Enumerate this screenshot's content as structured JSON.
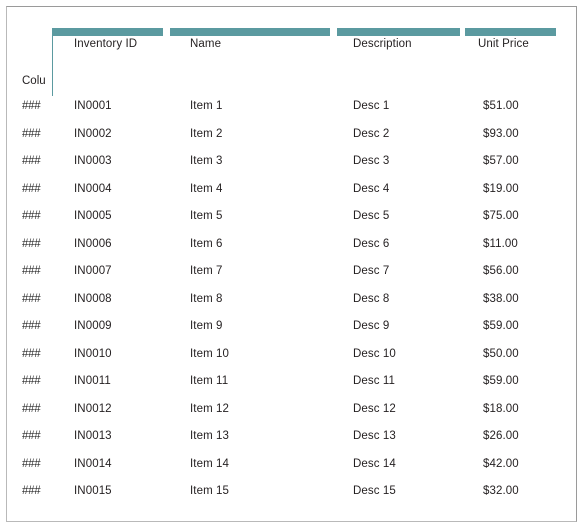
{
  "document": {
    "type": "inventory-table",
    "accent_color": "#5b9aa0",
    "text_color": "#231f20",
    "background_color": "#ffffff",
    "border_color": "#9a9a9a"
  },
  "table": {
    "row_header_stub": "Colu",
    "columns": [
      {
        "key": "row_num",
        "label": "",
        "banded": false
      },
      {
        "key": "inventory_id",
        "label": "Inventory ID",
        "banded": true
      },
      {
        "key": "name",
        "label": "Name",
        "banded": true
      },
      {
        "key": "description",
        "label": "Description",
        "banded": true
      },
      {
        "key": "unit_price",
        "label": "Unit Price",
        "banded": true
      }
    ],
    "rows": [
      {
        "row_num": "###",
        "inventory_id": "IN0001",
        "name": "Item 1",
        "description": "Desc 1",
        "unit_price": "$51.00"
      },
      {
        "row_num": "###",
        "inventory_id": "IN0002",
        "name": "Item 2",
        "description": "Desc 2",
        "unit_price": "$93.00"
      },
      {
        "row_num": "###",
        "inventory_id": "IN0003",
        "name": "Item 3",
        "description": "Desc 3",
        "unit_price": "$57.00"
      },
      {
        "row_num": "###",
        "inventory_id": "IN0004",
        "name": "Item 4",
        "description": "Desc 4",
        "unit_price": "$19.00"
      },
      {
        "row_num": "###",
        "inventory_id": "IN0005",
        "name": "Item 5",
        "description": "Desc 5",
        "unit_price": "$75.00"
      },
      {
        "row_num": "###",
        "inventory_id": "IN0006",
        "name": "Item 6",
        "description": "Desc 6",
        "unit_price": "$11.00"
      },
      {
        "row_num": "###",
        "inventory_id": "IN0007",
        "name": "Item 7",
        "description": "Desc 7",
        "unit_price": "$56.00"
      },
      {
        "row_num": "###",
        "inventory_id": "IN0008",
        "name": "Item 8",
        "description": "Desc 8",
        "unit_price": "$38.00"
      },
      {
        "row_num": "###",
        "inventory_id": "IN0009",
        "name": "Item 9",
        "description": "Desc 9",
        "unit_price": "$59.00"
      },
      {
        "row_num": "###",
        "inventory_id": "IN0010",
        "name": "Item 10",
        "description": "Desc 10",
        "unit_price": "$50.00"
      },
      {
        "row_num": "###",
        "inventory_id": "IN0011",
        "name": "Item 11",
        "description": "Desc 11",
        "unit_price": "$59.00"
      },
      {
        "row_num": "###",
        "inventory_id": "IN0012",
        "name": "Item 12",
        "description": "Desc 12",
        "unit_price": "$18.00"
      },
      {
        "row_num": "###",
        "inventory_id": "IN0013",
        "name": "Item 13",
        "description": "Desc 13",
        "unit_price": "$26.00"
      },
      {
        "row_num": "###",
        "inventory_id": "IN0014",
        "name": "Item 14",
        "description": "Desc 14",
        "unit_price": "$42.00"
      },
      {
        "row_num": "###",
        "inventory_id": "IN0015",
        "name": "Item 15",
        "description": "Desc 15",
        "unit_price": "$32.00"
      }
    ]
  }
}
